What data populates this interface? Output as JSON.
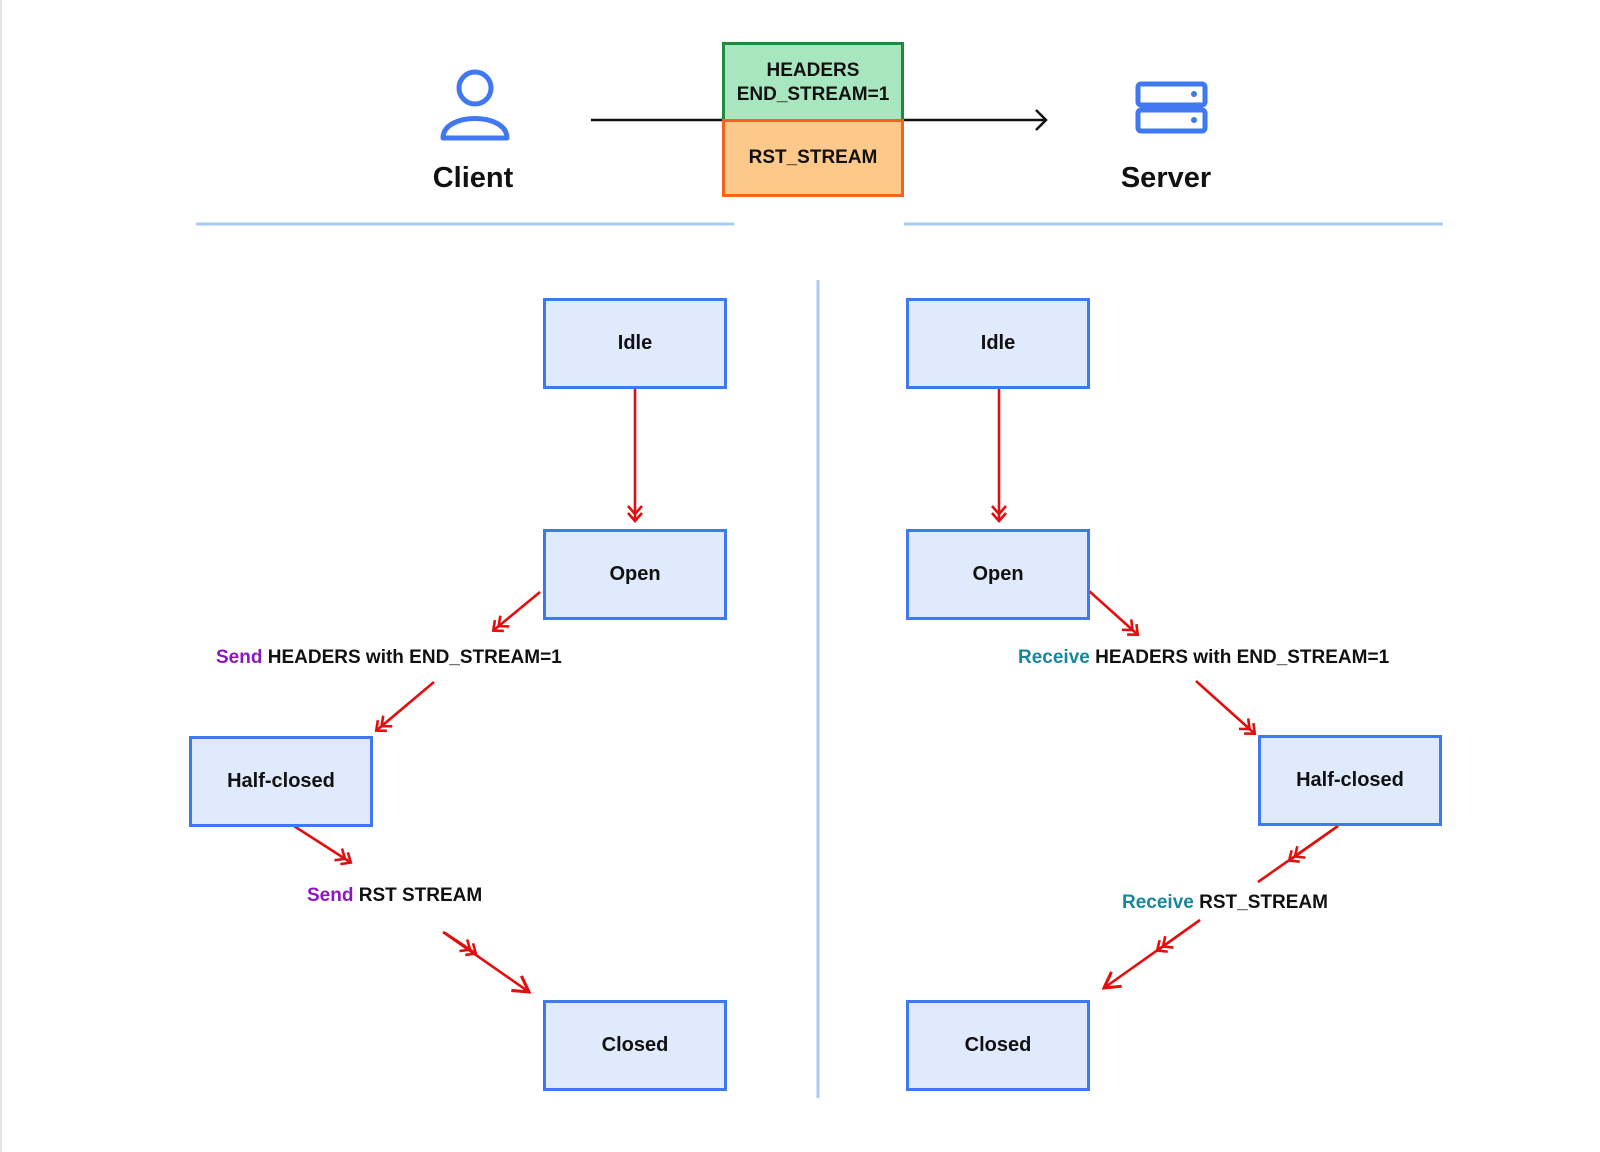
{
  "actors": {
    "client": {
      "label": "Client",
      "icon": "user-icon"
    },
    "server": {
      "label": "Server",
      "icon": "server-icon"
    }
  },
  "frames": [
    {
      "lines": [
        "HEADERS",
        "END_STREAM=1"
      ],
      "fill": "#a8e6bf",
      "border": "#1f8a3f"
    },
    {
      "lines": [
        "RST_STREAM"
      ],
      "fill": "#fdc98a",
      "border": "#f4641f"
    }
  ],
  "colors": {
    "accent_blue": "#3f78f0",
    "state_fill": "#dfeafc",
    "arrow_red": "#e01010",
    "send_purple": "#8a17c0",
    "receive_teal": "#17879c",
    "divider": "#a9cbf5"
  },
  "client_side": {
    "states": [
      "Idle",
      "Open",
      "Half-closed",
      "Closed"
    ],
    "transitions": [
      {
        "verb": "Send",
        "rest": "HEADERS with END_STREAM=1"
      },
      {
        "verb": "Send",
        "rest": "RST STREAM"
      }
    ]
  },
  "server_side": {
    "states": [
      "Idle",
      "Open",
      "Half-closed",
      "Closed"
    ],
    "transitions": [
      {
        "verb": "Receive",
        "rest": "HEADERS with END_STREAM=1"
      },
      {
        "verb": "Receive",
        "rest": "RST_STREAM"
      }
    ]
  }
}
